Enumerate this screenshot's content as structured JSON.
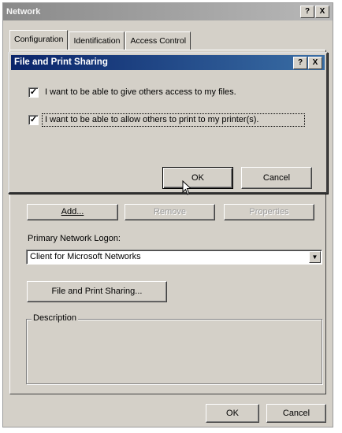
{
  "window": {
    "title": "Network",
    "help_btn": "?",
    "close_btn": "X"
  },
  "tabs": [
    {
      "label": "Configuration"
    },
    {
      "label": "Identification"
    },
    {
      "label": "Access Control"
    }
  ],
  "config": {
    "add_label": "Add...",
    "remove_label": "Remove",
    "properties_label": "Properties",
    "logon_label": "Primary Network Logon:",
    "logon_value": "Client for Microsoft Networks",
    "dropdown_arrow": "▼",
    "fps_label": "File and Print Sharing...",
    "description_label": "Description"
  },
  "footer": {
    "ok_label": "OK",
    "cancel_label": "Cancel"
  },
  "dialog": {
    "title": "File and Print Sharing",
    "help_btn": "?",
    "close_btn": "X",
    "check_mark": "✓",
    "option1": {
      "label": "I want to be able to give others access to my files.",
      "checked": true
    },
    "option2": {
      "label": "I want to be able to allow others to print to my printer(s).",
      "checked": true
    },
    "ok_label": "OK",
    "cancel_label": "Cancel"
  }
}
